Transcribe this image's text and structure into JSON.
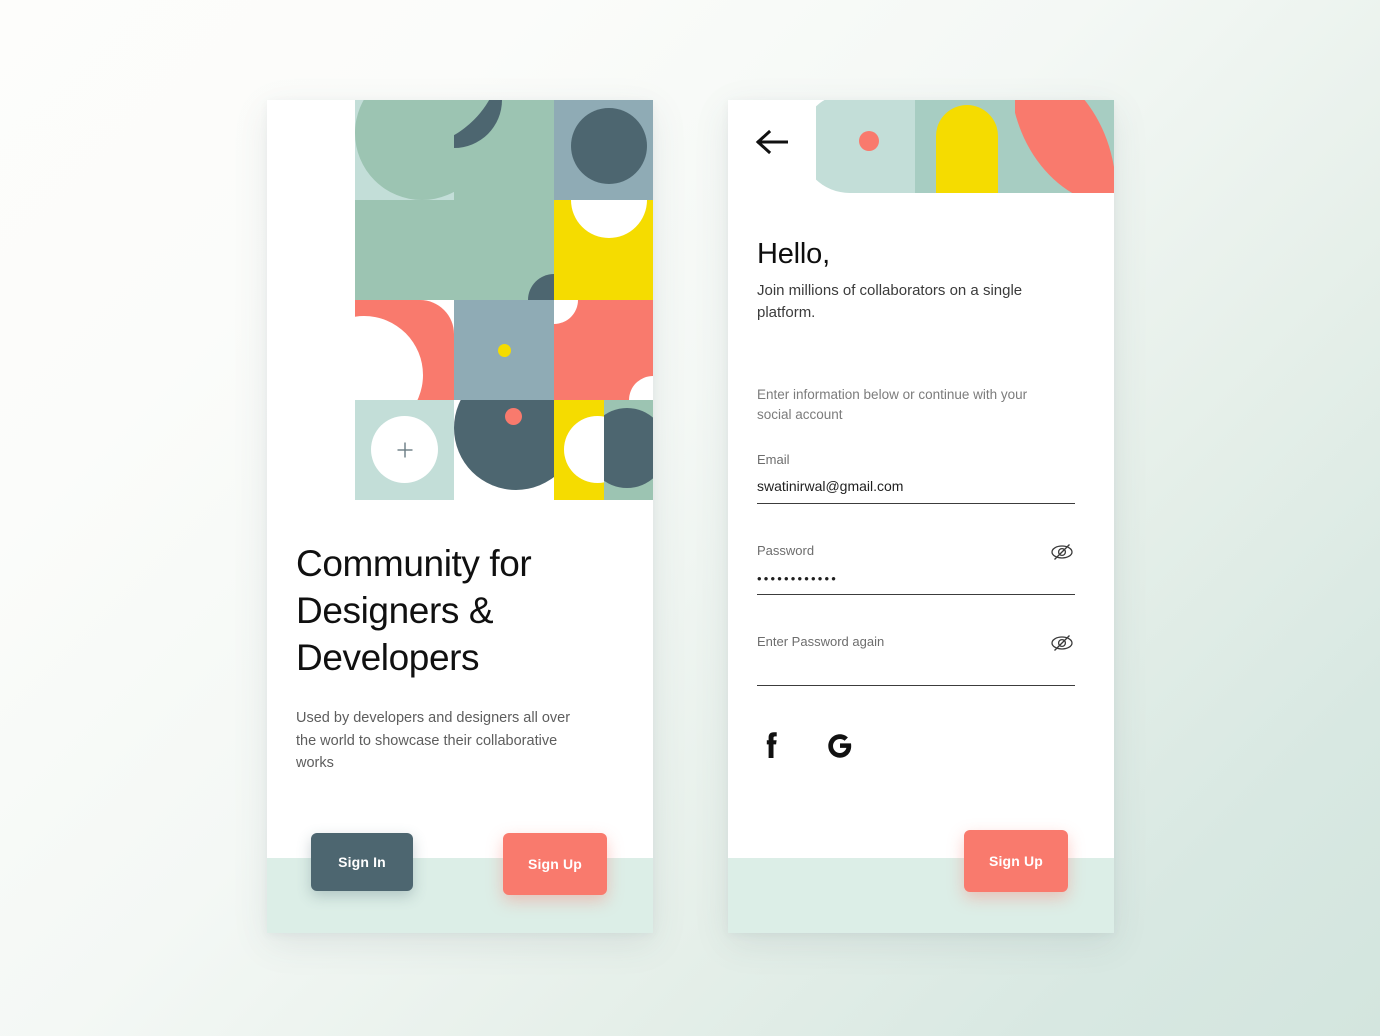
{
  "background": {
    "gradient_from": "#fdfdfb",
    "gradient_to": "#d3e5de"
  },
  "palette": {
    "coral": "#f97a6d",
    "yellow": "#f5dc00",
    "slate": "#4d6670",
    "sage": "#9cc4b2",
    "mint": "#c3ded8",
    "pale_mint": "#dceee7",
    "blue_grey": "#8fabb5",
    "white": "#ffffff"
  },
  "left_card": {
    "name": "onboarding-screen",
    "artwork": {
      "name": "geometric-pattern",
      "plus_icon": "plus-icon"
    },
    "headline": "Community for Designers & Developers",
    "subcopy": "Used by developers and designers all over the world to showcase their collaborative works",
    "buttons": {
      "sign_in": "Sign In",
      "sign_up": "Sign Up"
    }
  },
  "right_card": {
    "name": "sign-up-screen",
    "back_icon": "arrow-left-icon",
    "greeting": "Hello,",
    "greeting_sub": "Join millions of collaborators on a single platform.",
    "hint": "Enter information below or continue with your social account",
    "fields": [
      {
        "name": "email-field",
        "label": "Email",
        "value": "swatinirwal@gmail.com",
        "placeholder": "Email",
        "has_eye": false
      },
      {
        "name": "password-field",
        "label": "Password",
        "value": "••••••••••••",
        "placeholder": "Password",
        "has_eye": true,
        "eye_icon": "eye-off-icon"
      },
      {
        "name": "confirm-password-field",
        "label": "Enter Password again",
        "value": "",
        "placeholder": "Enter Password again",
        "has_eye": true,
        "eye_icon": "eye-off-icon"
      }
    ],
    "social": [
      {
        "name": "facebook-icon",
        "label": "f"
      },
      {
        "name": "google-icon",
        "label": "G"
      }
    ],
    "buttons": {
      "sign_up": "Sign Up"
    }
  }
}
